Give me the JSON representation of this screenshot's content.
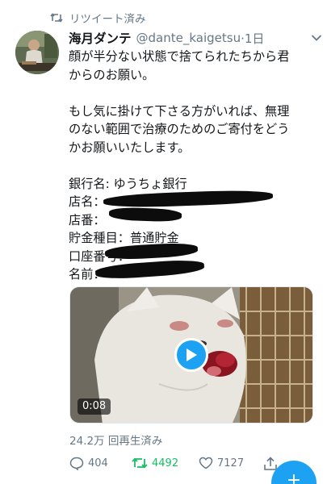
{
  "retweet": {
    "label": "リツイート済み",
    "icon": "retweet-icon"
  },
  "author": {
    "display_name": "海月ダンテ",
    "handle": "@dante_kaigetsu",
    "time": "·1日"
  },
  "tweet": {
    "line1": "顔が半分ない状態で捨てられたちから君",
    "line2": "からのお願い。",
    "line3": "もし気に掛けて下さる方がいれば、無理",
    "line4": "のない範囲で治療のためのご寄付をどう",
    "line5": "かお願いいたします。",
    "bank_name": "銀行名: ゆうちょ銀行",
    "branch_name": "店名：",
    "branch_no": "店番：",
    "account_type": "貯金種目：普通貯金",
    "account_no": "口座番号：",
    "holder": "名前："
  },
  "video": {
    "duration": "0:08",
    "views": "24.2万 回再生済み"
  },
  "actions": {
    "replies": "404",
    "retweets": "4492",
    "likes": "7127"
  },
  "colors": {
    "accent": "#1da1f2",
    "retweet_green": "#17bf63",
    "muted": "#657786",
    "text": "#14171a"
  },
  "fab": {
    "label": "+"
  }
}
